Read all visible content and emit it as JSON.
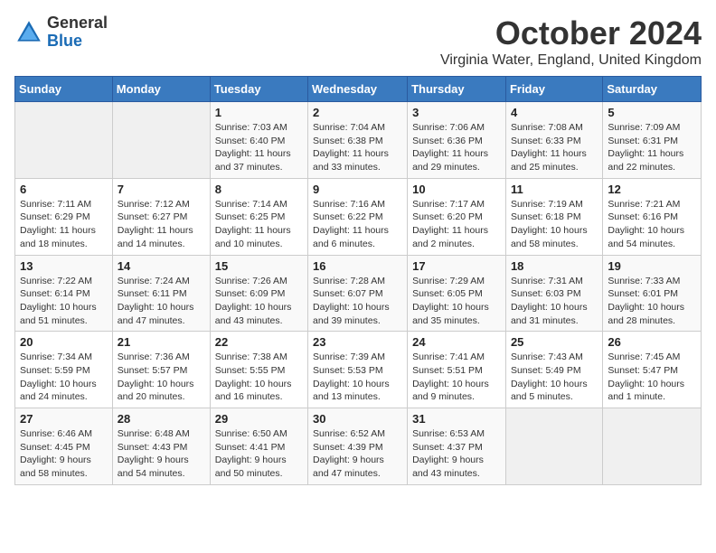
{
  "header": {
    "logo_general": "General",
    "logo_blue": "Blue",
    "month_title": "October 2024",
    "location": "Virginia Water, England, United Kingdom"
  },
  "weekdays": [
    "Sunday",
    "Monday",
    "Tuesday",
    "Wednesday",
    "Thursday",
    "Friday",
    "Saturday"
  ],
  "weeks": [
    [
      {
        "day": "",
        "info": ""
      },
      {
        "day": "",
        "info": ""
      },
      {
        "day": "1",
        "info": "Sunrise: 7:03 AM\nSunset: 6:40 PM\nDaylight: 11 hours and 37 minutes."
      },
      {
        "day": "2",
        "info": "Sunrise: 7:04 AM\nSunset: 6:38 PM\nDaylight: 11 hours and 33 minutes."
      },
      {
        "day": "3",
        "info": "Sunrise: 7:06 AM\nSunset: 6:36 PM\nDaylight: 11 hours and 29 minutes."
      },
      {
        "day": "4",
        "info": "Sunrise: 7:08 AM\nSunset: 6:33 PM\nDaylight: 11 hours and 25 minutes."
      },
      {
        "day": "5",
        "info": "Sunrise: 7:09 AM\nSunset: 6:31 PM\nDaylight: 11 hours and 22 minutes."
      }
    ],
    [
      {
        "day": "6",
        "info": "Sunrise: 7:11 AM\nSunset: 6:29 PM\nDaylight: 11 hours and 18 minutes."
      },
      {
        "day": "7",
        "info": "Sunrise: 7:12 AM\nSunset: 6:27 PM\nDaylight: 11 hours and 14 minutes."
      },
      {
        "day": "8",
        "info": "Sunrise: 7:14 AM\nSunset: 6:25 PM\nDaylight: 11 hours and 10 minutes."
      },
      {
        "day": "9",
        "info": "Sunrise: 7:16 AM\nSunset: 6:22 PM\nDaylight: 11 hours and 6 minutes."
      },
      {
        "day": "10",
        "info": "Sunrise: 7:17 AM\nSunset: 6:20 PM\nDaylight: 11 hours and 2 minutes."
      },
      {
        "day": "11",
        "info": "Sunrise: 7:19 AM\nSunset: 6:18 PM\nDaylight: 10 hours and 58 minutes."
      },
      {
        "day": "12",
        "info": "Sunrise: 7:21 AM\nSunset: 6:16 PM\nDaylight: 10 hours and 54 minutes."
      }
    ],
    [
      {
        "day": "13",
        "info": "Sunrise: 7:22 AM\nSunset: 6:14 PM\nDaylight: 10 hours and 51 minutes."
      },
      {
        "day": "14",
        "info": "Sunrise: 7:24 AM\nSunset: 6:11 PM\nDaylight: 10 hours and 47 minutes."
      },
      {
        "day": "15",
        "info": "Sunrise: 7:26 AM\nSunset: 6:09 PM\nDaylight: 10 hours and 43 minutes."
      },
      {
        "day": "16",
        "info": "Sunrise: 7:28 AM\nSunset: 6:07 PM\nDaylight: 10 hours and 39 minutes."
      },
      {
        "day": "17",
        "info": "Sunrise: 7:29 AM\nSunset: 6:05 PM\nDaylight: 10 hours and 35 minutes."
      },
      {
        "day": "18",
        "info": "Sunrise: 7:31 AM\nSunset: 6:03 PM\nDaylight: 10 hours and 31 minutes."
      },
      {
        "day": "19",
        "info": "Sunrise: 7:33 AM\nSunset: 6:01 PM\nDaylight: 10 hours and 28 minutes."
      }
    ],
    [
      {
        "day": "20",
        "info": "Sunrise: 7:34 AM\nSunset: 5:59 PM\nDaylight: 10 hours and 24 minutes."
      },
      {
        "day": "21",
        "info": "Sunrise: 7:36 AM\nSunset: 5:57 PM\nDaylight: 10 hours and 20 minutes."
      },
      {
        "day": "22",
        "info": "Sunrise: 7:38 AM\nSunset: 5:55 PM\nDaylight: 10 hours and 16 minutes."
      },
      {
        "day": "23",
        "info": "Sunrise: 7:39 AM\nSunset: 5:53 PM\nDaylight: 10 hours and 13 minutes."
      },
      {
        "day": "24",
        "info": "Sunrise: 7:41 AM\nSunset: 5:51 PM\nDaylight: 10 hours and 9 minutes."
      },
      {
        "day": "25",
        "info": "Sunrise: 7:43 AM\nSunset: 5:49 PM\nDaylight: 10 hours and 5 minutes."
      },
      {
        "day": "26",
        "info": "Sunrise: 7:45 AM\nSunset: 5:47 PM\nDaylight: 10 hours and 1 minute."
      }
    ],
    [
      {
        "day": "27",
        "info": "Sunrise: 6:46 AM\nSunset: 4:45 PM\nDaylight: 9 hours and 58 minutes."
      },
      {
        "day": "28",
        "info": "Sunrise: 6:48 AM\nSunset: 4:43 PM\nDaylight: 9 hours and 54 minutes."
      },
      {
        "day": "29",
        "info": "Sunrise: 6:50 AM\nSunset: 4:41 PM\nDaylight: 9 hours and 50 minutes."
      },
      {
        "day": "30",
        "info": "Sunrise: 6:52 AM\nSunset: 4:39 PM\nDaylight: 9 hours and 47 minutes."
      },
      {
        "day": "31",
        "info": "Sunrise: 6:53 AM\nSunset: 4:37 PM\nDaylight: 9 hours and 43 minutes."
      },
      {
        "day": "",
        "info": ""
      },
      {
        "day": "",
        "info": ""
      }
    ]
  ]
}
